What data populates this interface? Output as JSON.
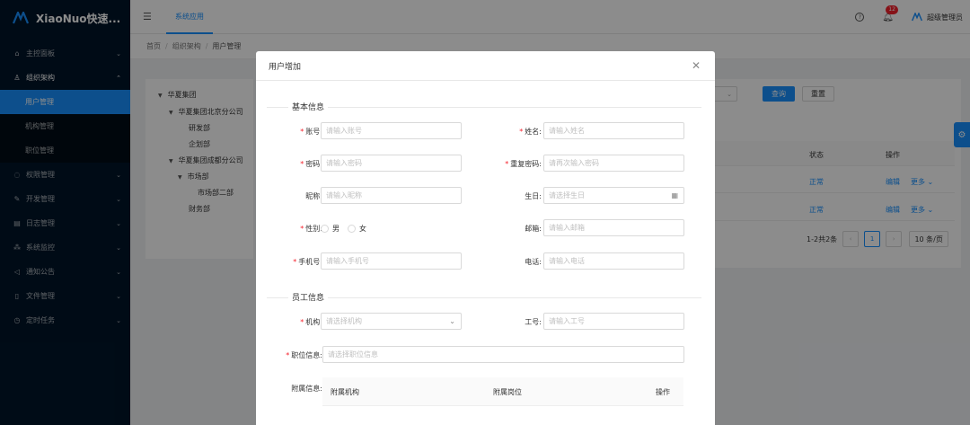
{
  "app": {
    "name": "XiaoNuo快速..."
  },
  "sidebar": {
    "items": [
      {
        "label": "主控面板",
        "icon": "home-icon",
        "expandable": true
      },
      {
        "label": "组织架构",
        "icon": "team-icon",
        "expandable": true,
        "expanded": true
      },
      {
        "label": "权限管理",
        "icon": "safety-icon",
        "expandable": true
      },
      {
        "label": "开发管理",
        "icon": "tool-icon",
        "expandable": true
      },
      {
        "label": "日志管理",
        "icon": "log-icon",
        "expandable": true
      },
      {
        "label": "系统监控",
        "icon": "cluster-icon",
        "expandable": true
      },
      {
        "label": "通知公告",
        "icon": "sound-icon",
        "expandable": true
      },
      {
        "label": "文件管理",
        "icon": "file-icon",
        "expandable": true
      },
      {
        "label": "定时任务",
        "icon": "clock-icon",
        "expandable": true
      }
    ],
    "subitems": [
      {
        "label": "用户管理",
        "active": true
      },
      {
        "label": "机构管理"
      },
      {
        "label": "职位管理"
      }
    ]
  },
  "header": {
    "app_tab": "系统应用",
    "notification_count": "12",
    "user_name": "超级管理员"
  },
  "breadcrumb": [
    "首页",
    "组织架构",
    "用户管理"
  ],
  "org_tree": [
    {
      "label": "华夏集团",
      "level": 0,
      "toggle": true
    },
    {
      "label": "华夏集团北京分公司",
      "level": 1,
      "toggle": true
    },
    {
      "label": "研发部",
      "level": 2
    },
    {
      "label": "企划部",
      "level": 2
    },
    {
      "label": "华夏集团成都分公司",
      "level": 1,
      "toggle": true
    },
    {
      "label": "市场部",
      "level": 2,
      "toggle": true
    },
    {
      "label": "市场部二部",
      "level": 3
    },
    {
      "label": "财务部",
      "level": 2
    }
  ],
  "toolbar": {
    "query_label": "查询",
    "reset_label": "重置"
  },
  "table": {
    "headers": {
      "status": "状态",
      "ops": "操作"
    },
    "rows": [
      {
        "status": "正常",
        "edit": "编辑",
        "more": "更多"
      },
      {
        "status": "正常",
        "edit": "编辑",
        "more": "更多"
      }
    ]
  },
  "pagination": {
    "summary": "1-2共2条",
    "current": "1",
    "page_size": "10 条/页"
  },
  "modal": {
    "title": "用户增加",
    "section_basic": "基本信息",
    "section_staff": "员工信息",
    "fields": {
      "account": {
        "label": "账号:",
        "placeholder": "请输入账号",
        "required": true
      },
      "name": {
        "label": "姓名:",
        "placeholder": "请输入姓名",
        "required": true
      },
      "password": {
        "label": "密码:",
        "placeholder": "请输入密码",
        "required": true
      },
      "confirm_password": {
        "label": "重复密码:",
        "placeholder": "请再次输入密码",
        "required": true
      },
      "nickname": {
        "label": "昵称:",
        "placeholder": "请输入昵称"
      },
      "birthday": {
        "label": "生日:",
        "placeholder": "请选择生日"
      },
      "gender": {
        "label": "性别:",
        "required": true,
        "options": [
          "男",
          "女"
        ]
      },
      "email": {
        "label": "邮箱:",
        "placeholder": "请输入邮箱"
      },
      "phone": {
        "label": "手机号:",
        "placeholder": "请输入手机号",
        "required": true
      },
      "tel": {
        "label": "电话:",
        "placeholder": "请输入电话"
      },
      "org": {
        "label": "机构:",
        "placeholder": "请选择机构",
        "required": true
      },
      "job_no": {
        "label": "工号:",
        "placeholder": "请输入工号"
      },
      "position": {
        "label": "职位信息:",
        "placeholder": "请选择职位信息",
        "required": true
      },
      "extra": {
        "label": "附属信息:"
      }
    },
    "extra_table": {
      "col_org": "附属机构",
      "col_pos": "附属岗位",
      "col_ops": "操作"
    }
  }
}
